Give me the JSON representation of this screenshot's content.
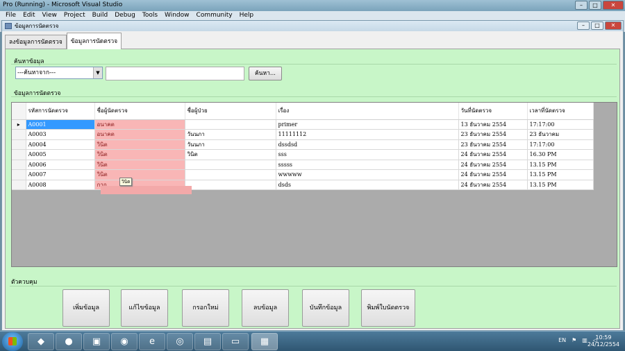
{
  "vs": {
    "title": "Pro (Running) - Microsoft Visual Studio",
    "menu": [
      "File",
      "Edit",
      "View",
      "Project",
      "Build",
      "Debug",
      "Tools",
      "Window",
      "Community",
      "Help"
    ]
  },
  "form": {
    "title": "ข้อมูลการนัดตรวจ",
    "tabs": [
      "ลงข้อมูลการนัดตรวจ",
      "ข้อมูลการนัดตรวจ"
    ],
    "search_group": "ค้นหาข้อมูล",
    "search_combo": "---ค้นหาจาก---",
    "search_input_value": "",
    "search_button": "ค้นหา...",
    "data_group": "ข้อมูลการนัดตรวจ",
    "control_group": "ตัวควบคุม",
    "tooltip": "วินิต"
  },
  "grid": {
    "columns": [
      "รหัสการนัดตรวจ",
      "ชื่อผู้นัดตรวจ",
      "ชื่อผู้ป่วย",
      "เรื่อง",
      "วันที่นัดตรวจ",
      "เวลาที่นัดตรวจ"
    ],
    "rows": [
      [
        "A0001",
        "อนาคต",
        "",
        "primer",
        "13 ธันวาคม 2554",
        "17:17:00"
      ],
      [
        "A0003",
        "อนาคต",
        "วันนภา",
        "11111112",
        "23 ธันวาคม 2554",
        "23 ธันวาคม"
      ],
      [
        "A0004",
        "วินิต",
        "วันนภา",
        "dssdsd",
        "23 ธันวาคม 2554",
        "17:17:00"
      ],
      [
        "A0005",
        "วินิต",
        "วินิต",
        "sss",
        "24 ธันวาคม 2554",
        "16.30 PM"
      ],
      [
        "A0006",
        "วินิต",
        "",
        "sssss",
        "24 ธันวาคม 2554",
        "13.15 PM"
      ],
      [
        "A0007",
        "วินิต",
        "",
        "wwwww",
        "24 ธันวาคม 2554",
        "13.15 PM"
      ],
      [
        "A0008",
        "กาก",
        "",
        "dsds",
        "24 ธันวาคม 2554",
        "13.15 PM"
      ]
    ],
    "current_row_marker": "▸"
  },
  "buttons": [
    "เพิ่มข้อมูล",
    "แก้ไขข้อมูล",
    "กรอกใหม่",
    "ลบข้อมูล",
    "บันทึกข้อมูล",
    "พิมพ์ใบนัดตรวจ"
  ],
  "taskbar": {
    "lang": "EN",
    "time": "10:59",
    "date": "24/12/2554"
  }
}
